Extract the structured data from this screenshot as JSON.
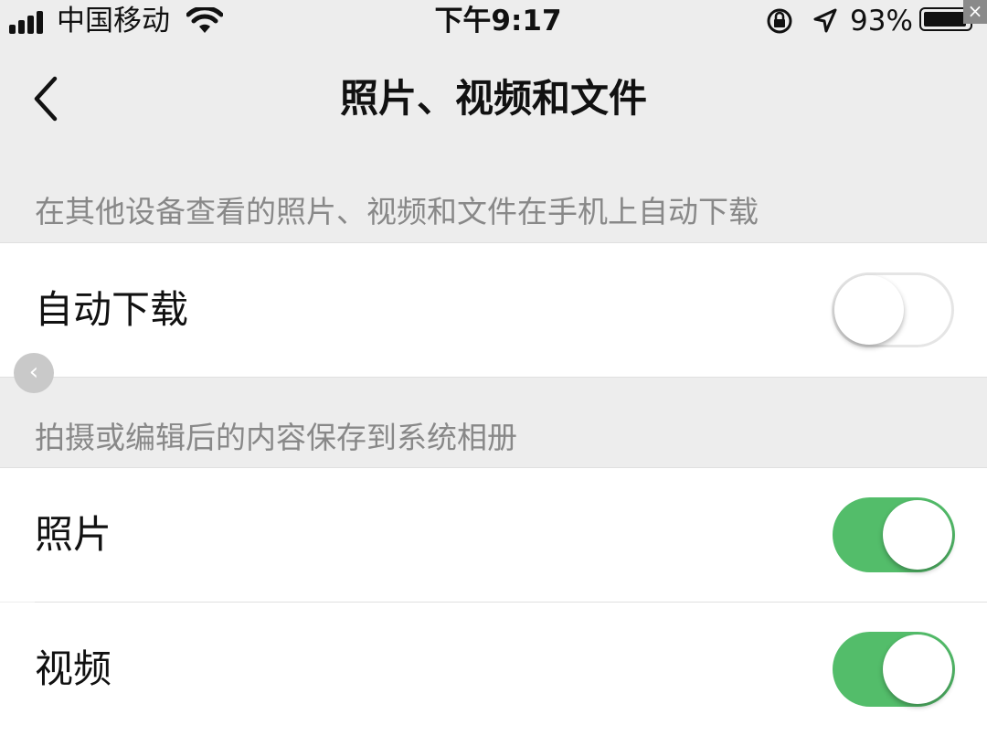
{
  "status_bar": {
    "carrier": "中国移动",
    "time": "下午9:17",
    "battery_percent": "93%",
    "icons": [
      "signal-icon",
      "wifi-icon",
      "rotation-lock-icon",
      "location-arrow-icon",
      "battery-icon"
    ]
  },
  "nav": {
    "back_icon": "chevron-left-icon",
    "title": "照片、视频和文件"
  },
  "sections": {
    "auto_download": {
      "header": "在其他设备查看的照片、视频和文件在手机上自动下载",
      "row_label": "自动下载",
      "toggle_on": false
    },
    "save_to_album": {
      "header": "拍摄或编辑后的内容保存到系统相册",
      "rows": [
        {
          "label": "照片",
          "toggle_on": true
        },
        {
          "label": "视频",
          "toggle_on": true
        }
      ]
    }
  },
  "colors": {
    "toggle_on": "#53bd6a",
    "background": "#ededed",
    "header_text": "#888888"
  },
  "overlay": {
    "close_glyph": "×",
    "handle_glyph": "‹"
  }
}
